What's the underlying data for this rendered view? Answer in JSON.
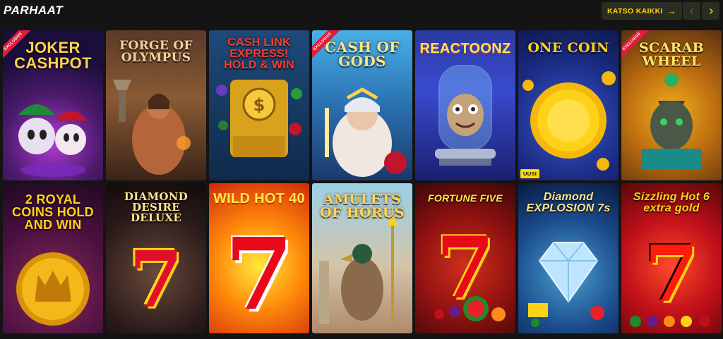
{
  "header": {
    "title": "PARHAAT",
    "see_all_label": "KATSO KAIKKI"
  },
  "icons": {
    "see_all": "arrow-right-icon",
    "prev": "chevron-left-icon",
    "next": "chevron-right-icon"
  },
  "colors": {
    "accent": "#ffd700",
    "button_bg": "#2a2d22",
    "page_bg": "#141414",
    "ribbon": "#e01c3a"
  },
  "games": [
    {
      "title": "JOKER CASHPOT",
      "ribbon": "EXCLUSIVE"
    },
    {
      "title": "FORGE OF OLYMPUS"
    },
    {
      "title": "CASH LINK EXPRESS! HOLD & WIN"
    },
    {
      "title": "CASH OF GODS",
      "ribbon": "EXCLUSIVE"
    },
    {
      "title": "REACTOONZ"
    },
    {
      "title": "ONE COIN",
      "badge": "UUSI"
    },
    {
      "title": "SCARAB WHEEL",
      "ribbon": "EXCLUSIVE"
    },
    {
      "title": "2 ROYAL COINS HOLD AND WIN"
    },
    {
      "title": "DIAMOND DESIRE DELUXE"
    },
    {
      "title": "WILD HOT 40"
    },
    {
      "title": "AMULETS OF HORUS"
    },
    {
      "title": "FORTUNE FIVE"
    },
    {
      "title": "Diamond EXPLOSION 7s"
    },
    {
      "title": "Sizzling Hot 6 extra gold"
    }
  ]
}
